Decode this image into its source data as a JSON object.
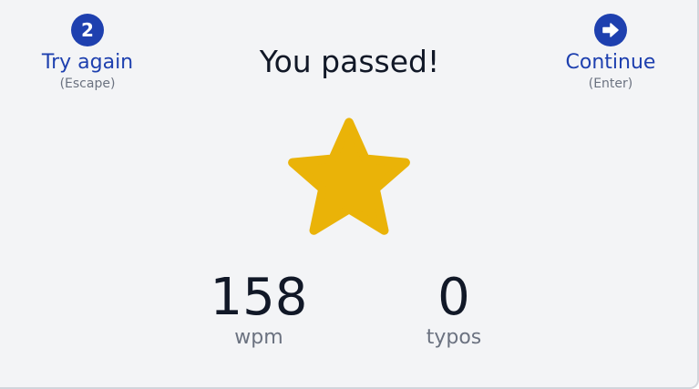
{
  "colors": {
    "accent": "#1e40af",
    "star": "#eab308",
    "background": "#f3f4f6",
    "text": "#111827",
    "muted": "#6b7280"
  },
  "try_again": {
    "icon_text": "2",
    "label": "Try again",
    "shortcut": "(Escape)"
  },
  "continue": {
    "icon": "arrow-right-icon",
    "label": "Continue",
    "shortcut": "(Enter)"
  },
  "result": {
    "title": "You passed!",
    "star_icon": "star-icon"
  },
  "stats": {
    "wpm": {
      "value": "158",
      "label": "wpm"
    },
    "typos": {
      "value": "0",
      "label": "typos"
    }
  }
}
